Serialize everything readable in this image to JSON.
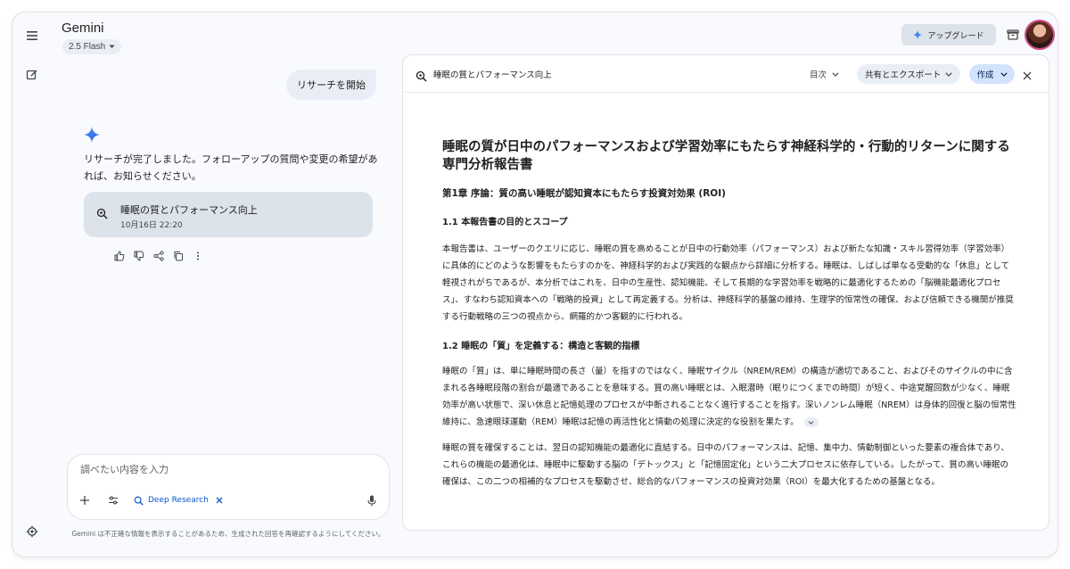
{
  "app": {
    "brand": "Gemini",
    "model": "2.5 Flash",
    "upgrade_label": "アップグレード"
  },
  "chat": {
    "user_message": "リサーチを開始",
    "reply": "リサーチが完了しました。フォローアップの質問や変更の希望があれば、お知らせください。",
    "research_card": {
      "title": "睡眠の質とパフォーマンス向上",
      "timestamp": "10月16日 22:20"
    }
  },
  "composer": {
    "placeholder": "調べたい内容を入力",
    "deep_research_label": "Deep Research"
  },
  "disclaimer": "Gemini は不正確な情報を表示することがあるため、生成された回答を再確認するようにしてください。",
  "panel": {
    "title": "睡眠の質とパフォーマンス向上",
    "toc_label": "目次",
    "share_label": "共有とエクスポート",
    "create_label": "作成"
  },
  "report": {
    "heading": "睡眠の質が日中のパフォーマンスおよび学習効率にもたらす神経科学的・行動的リターンに関する専門分析報告書",
    "chapter1": "第1章 序論：質の高い睡眠が認知資本にもたらす投資対効果 (ROI)",
    "s1_1": "1.1 本報告書の目的とスコープ",
    "p1": "本報告書は、ユーザーのクエリに応じ、睡眠の質を高めることが日中の行動効率（パフォーマンス）および新たな知識・スキル習得効率（学習効率）に具体的にどのような影響をもたらすのかを、神経科学的および実践的な観点から詳細に分析する。睡眠は、しばしば単なる受動的な「休息」として軽視されがちであるが、本分析ではこれを、日中の生産性、認知機能、そして長期的な学習効率を戦略的に最適化するための「脳機能最適化プロセス」、すなわち認知資本への「戦略的投資」として再定義する。分析は、神経科学的基盤の維持、生理学的恒常性の確保、および信頼できる機関が推奨する行動戦略の三つの視点から、網羅的かつ客観的に行われる。",
    "s1_2": "1.2 睡眠の「質」を定義する：構造と客観的指標",
    "p2": "睡眠の「質」は、単に睡眠時間の長さ（量）を指すのではなく、睡眠サイクル（NREM/REM）の構造が適切であること、およびそのサイクルの中に含まれる各睡眠段階の割合が最適であることを意味する。質の高い睡眠とは、入眠潜時（眠りにつくまでの時間）が短く、中途覚醒回数が少なく、睡眠効率が高い状態で、深い休息と記憶処理のプロセスが中断されることなく進行することを指す。深いノンレム睡眠（NREM）は身体的回復と脳の恒常性維持に、急速眼球運動（REM）睡眠は記憶の再活性化と情動の処理に決定的な役割を果たす。",
    "p3": "睡眠の質を確保することは、翌日の認知機能の最適化に直結する。日中のパフォーマンスは、記憶、集中力、情動制御といった要素の複合体であり、これらの機能の最適化は、睡眠中に駆動する脳の「デトックス」と「記憶固定化」という二大プロセスに依存している。したがって、質の高い睡眠の確保は、この二つの相補的なプロセスを駆動させ、総合的なパフォーマンスの投資対効果（ROI）を最大化するための基盤となる。"
  },
  "colors": {
    "accent_blue": "#0b57d0",
    "surface": "#f8fafd",
    "chip": "#e9eef6",
    "card": "#dde3ea",
    "create_chip": "#d3e3fd"
  }
}
